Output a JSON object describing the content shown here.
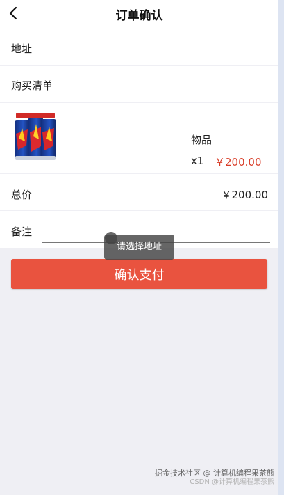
{
  "header": {
    "title": "订单确认",
    "back_icon": "back-arrow-icon"
  },
  "address": {
    "label": "地址"
  },
  "cart": {
    "label": "购买清单",
    "item": {
      "name": "物品",
      "quantity": "x1",
      "price": "￥200.00",
      "image_icon": "product-can-image"
    }
  },
  "total": {
    "label": "总价",
    "value": "￥200.00"
  },
  "remark": {
    "label": "备注",
    "value": "",
    "placeholder": ""
  },
  "actions": {
    "pay_label": "确认支付"
  },
  "toast": {
    "message": "请选择地址"
  },
  "watermark": {
    "line1": "掘金技术社区 @ 计算机编程果茶熊",
    "line2": "CSDN @计算机编程果茶熊"
  },
  "colors": {
    "accent": "#e9533f",
    "price": "#d83b26",
    "background": "#efeff4",
    "panel": "#ffffff"
  }
}
